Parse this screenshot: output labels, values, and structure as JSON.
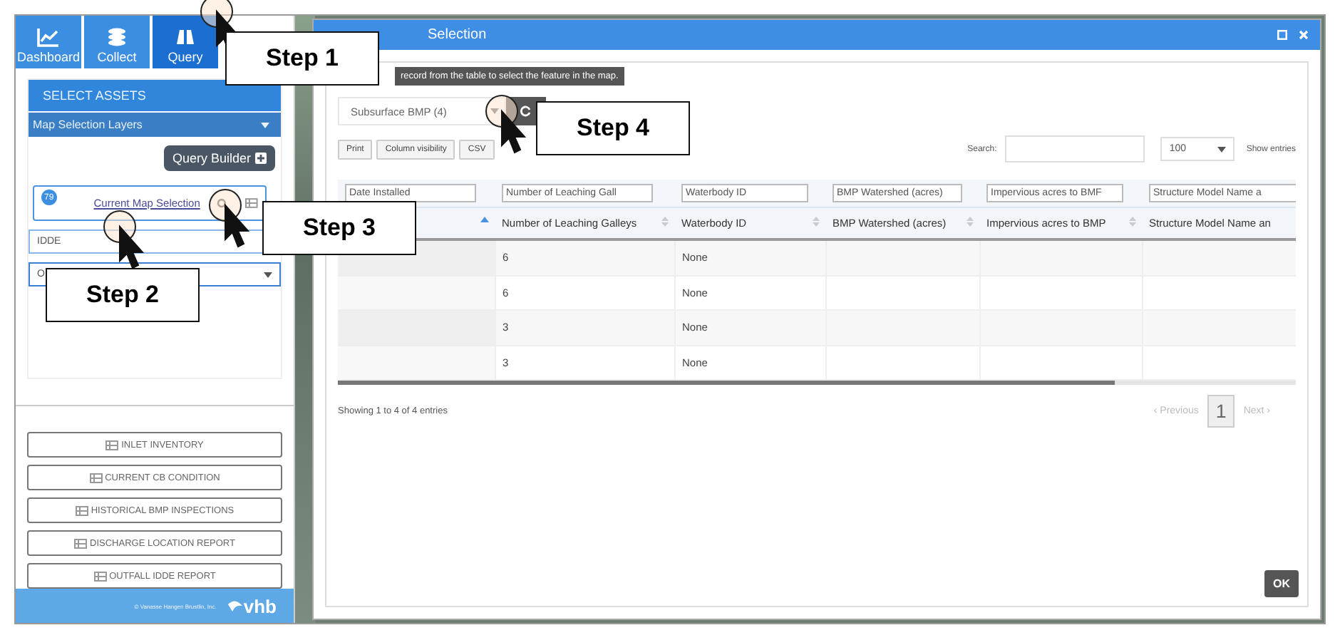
{
  "sidebar": {
    "tabs": [
      {
        "label": "Dashboard",
        "selected": false
      },
      {
        "label": "Collect",
        "selected": false
      },
      {
        "label": "Query",
        "selected": true
      }
    ],
    "panel_title": "SELECT ASSETS",
    "layers_dropdown": "Map Selection Layers",
    "query_builder": "Query Builder",
    "selection": {
      "badge": "79",
      "link": "Current Map Selection"
    },
    "layer_field": "IDDE",
    "dropdown_value": "O",
    "reports": [
      "INLET INVENTORY",
      "CURRENT CB CONDITION",
      "HISTORICAL BMP INSPECTIONS",
      "DISCHARGE LOCATION REPORT",
      "OUTFALL IDDE REPORT"
    ],
    "footer": {
      "copyright": "© Vanasse Hangen Brustlin, Inc.",
      "logo": "vhb"
    }
  },
  "dialog": {
    "title": "Selection",
    "hint": "record from the table to select the feature in the map.",
    "layer_select": "Subsurface BMP (4)",
    "buttons": [
      "Print",
      "Column visibility",
      "CSV"
    ],
    "search_label": "Search:",
    "page_size": "100",
    "show_entries": "Show entries",
    "filters": [
      "Date Installed",
      "Number of Leaching Gall",
      "Waterbody ID",
      "BMP Watershed (acres)",
      "Impervious acres to BMF",
      "Structure Model Name a"
    ],
    "columns": [
      {
        "sorted": true
      },
      {
        "label": "Number of Leaching Galleys",
        "sorted": false
      },
      {
        "label": "Waterbody ID",
        "sorted": false
      },
      {
        "label": "BMP Watershed (acres)",
        "sorted": false
      },
      {
        "label": "Impervious acres to BMP",
        "sorted": false
      },
      {
        "label": "Structure Model Name an"
      }
    ],
    "rows": [
      {
        "galleys": "6",
        "waterbody": "None"
      },
      {
        "galleys": "6",
        "waterbody": "None"
      },
      {
        "galleys": "3",
        "waterbody": "None"
      },
      {
        "galleys": "3",
        "waterbody": "None"
      }
    ],
    "info": "Showing 1 to 4 of 4 entries",
    "previous": "‹ Previous",
    "page": "1",
    "next": "Next ›",
    "ok": "OK"
  },
  "callouts": [
    {
      "label": "Step 1"
    },
    {
      "label": "Step 2"
    },
    {
      "label": "Step 3"
    },
    {
      "label": "Step 4"
    }
  ]
}
